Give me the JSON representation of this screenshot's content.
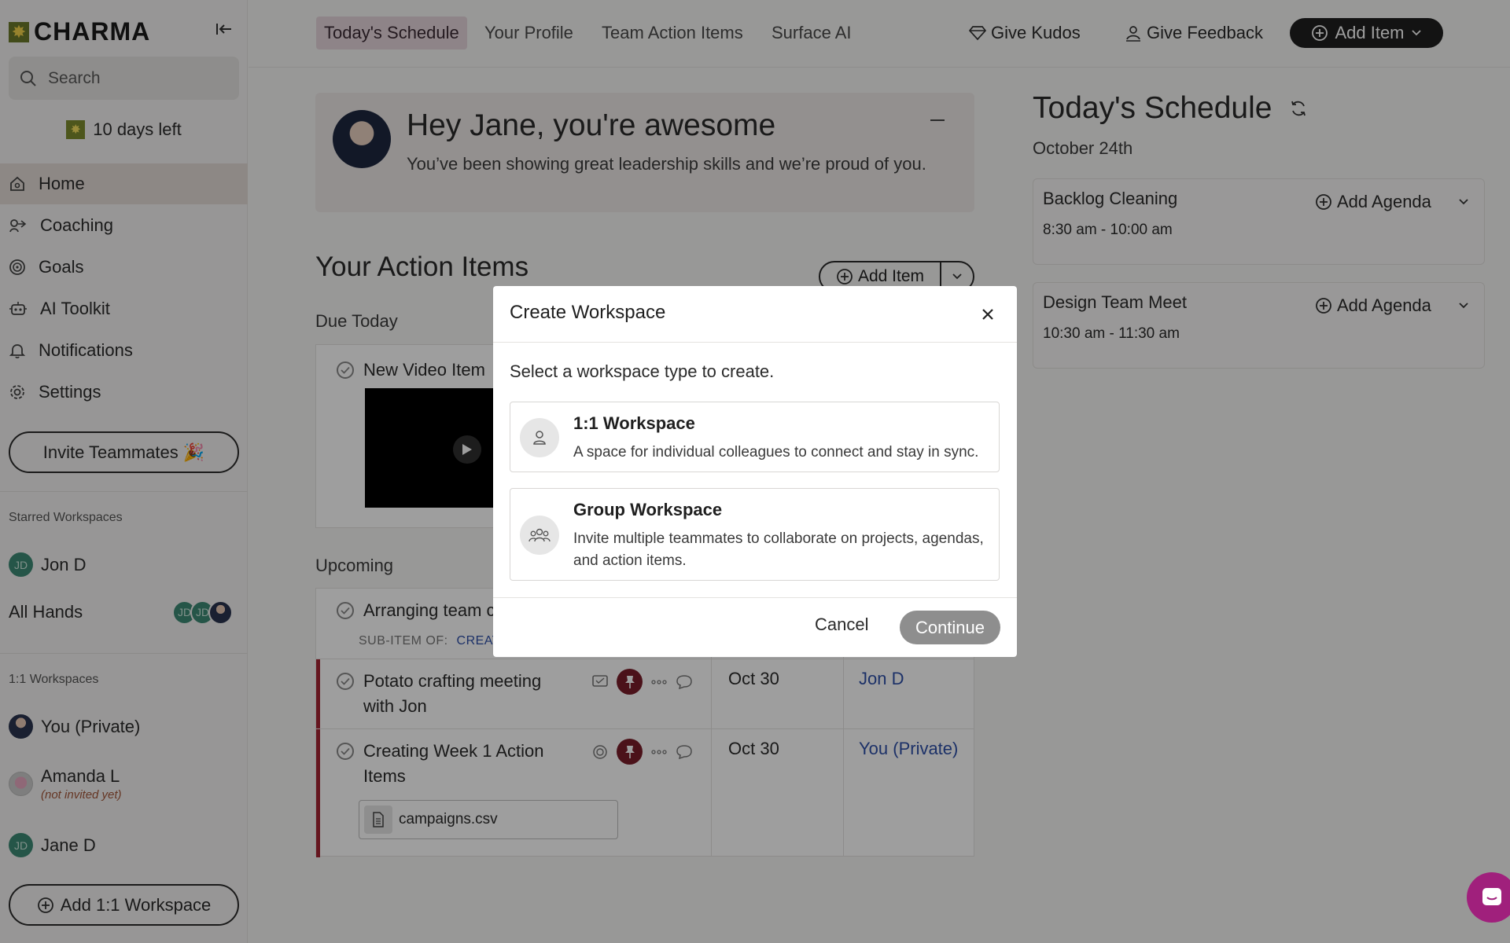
{
  "brand": {
    "name": "CHARMA"
  },
  "sidebar": {
    "search_placeholder": "Search",
    "trial": "10 days left",
    "nav": [
      {
        "label": "Home",
        "icon": "home-icon",
        "active": true
      },
      {
        "label": "Coaching",
        "icon": "coaching-icon"
      },
      {
        "label": "Goals",
        "icon": "goals-icon"
      },
      {
        "label": "AI Toolkit",
        "icon": "robot-icon"
      },
      {
        "label": "Notifications",
        "icon": "bell-icon"
      },
      {
        "label": "Settings",
        "icon": "gear-icon"
      }
    ],
    "invite_label": "Invite Teammates 🎉",
    "starred_label": "Starred Workspaces",
    "starred": [
      {
        "name": "Jon D",
        "initials": "JD"
      },
      {
        "name": "All Hands",
        "avatars": [
          "JD",
          "JD"
        ]
      }
    ],
    "one_on_one_label": "1:1 Workspaces",
    "one_on_one": [
      {
        "name": "You (Private)"
      },
      {
        "name": "Amanda L",
        "note": "(not invited yet)"
      },
      {
        "name": "Jane D",
        "initials": "JD"
      }
    ],
    "add_ws_label": "Add 1:1 Workspace"
  },
  "topnav": {
    "tabs": [
      "Today's Schedule",
      "Your Profile",
      "Team Action Items",
      "Surface AI"
    ],
    "active_tab": 0,
    "kudos": "Give Kudos",
    "feedback": "Give Feedback",
    "add_item": "Add Item"
  },
  "kudos_card": {
    "title": "Hey Jane, you're awesome",
    "message": "You’ve been showing great leadership skills and we’re proud of you."
  },
  "action_items": {
    "heading": "Your Action Items",
    "add_item": "Add Item",
    "due_today_label": "Due Today",
    "due_today": [
      {
        "title": "New Video Item"
      }
    ],
    "upcoming_label": "Upcoming",
    "upcoming": [
      {
        "title": "Arranging team c",
        "sub_item_of_label": "SUB-ITEM OF:",
        "sub_item_of": "CREAT"
      },
      {
        "title_line1": "Potato crafting meeting",
        "title_line2": "with Jon",
        "date": "Oct 30",
        "owner": "Jon D"
      },
      {
        "title_line1": "Creating Week 1 Action",
        "title_line2": "Items",
        "date": "Oct 30",
        "owner": "You (Private)",
        "file": "campaigns.csv"
      }
    ]
  },
  "schedule": {
    "title": "Today's Schedule",
    "date": "October 24th",
    "meetings": [
      {
        "title": "Backlog Cleaning",
        "time": "8:30 am - 10:00 am",
        "agenda": "Add Agenda"
      },
      {
        "title": "Design Team Meet",
        "time": "10:30 am - 11:30 am",
        "agenda": "Add Agenda"
      }
    ]
  },
  "modal": {
    "title": "Create Workspace",
    "prompt": "Select a workspace type to create.",
    "options": [
      {
        "title": "1:1 Workspace",
        "desc": "A space for individual colleagues to connect and stay in sync.",
        "icon": "person-icon"
      },
      {
        "title": "Group Workspace",
        "desc": "Invite multiple teammates to collaborate on projects, agendas, and action items.",
        "icon": "group-icon"
      }
    ],
    "cancel": "Cancel",
    "continue": "Continue"
  }
}
